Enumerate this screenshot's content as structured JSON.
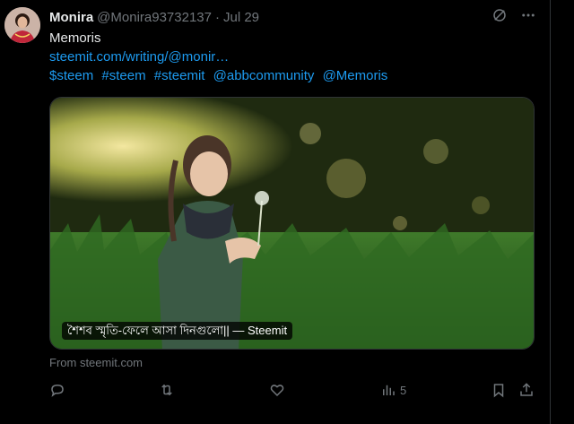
{
  "tweet": {
    "author_name": "Monira",
    "author_handle": "@Monira93732137",
    "separator": "·",
    "date": "Jul 29",
    "text_title": "Memoris",
    "link": "steemit.com/writing/@monir…",
    "tags": [
      "$steem",
      "#steem",
      "#steemit",
      "@abbcommunity",
      "@Memoris"
    ]
  },
  "card": {
    "title": "শৈশব স্মৃতি-ফেলে আসা দিনগুলো|| — Steemit",
    "source": "From steemit.com"
  },
  "actions": {
    "views_count": "5"
  },
  "icons": {
    "grok": "grok-icon",
    "more": "more-icon",
    "reply": "reply-icon",
    "retweet": "retweet-icon",
    "like": "like-icon",
    "views": "views-icon",
    "bookmark": "bookmark-icon",
    "share": "share-icon"
  },
  "colors": {
    "background": "#000000",
    "text_primary": "#e7e9ea",
    "text_secondary": "#71767b",
    "link": "#1d9bf0",
    "border": "#2f3336"
  }
}
